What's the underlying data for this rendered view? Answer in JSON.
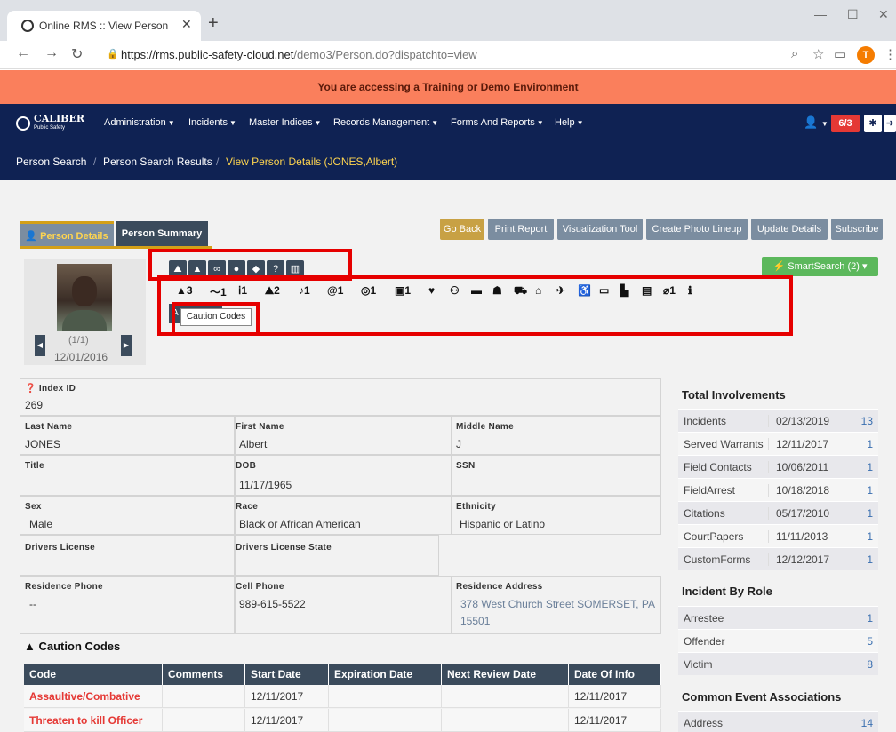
{
  "browser": {
    "tab_title": "Online RMS :: View Person Details",
    "url_host": "https://rms.public-safety-cloud.net",
    "url_path": "/demo3/Person.do?dispatchto=view",
    "profile_initial": "T"
  },
  "banner": "You are accessing a Training or Demo Environment",
  "nav": {
    "logo": "CALIBER",
    "logo_sub": "Public Safety",
    "menus": [
      "Administration",
      "Incidents",
      "Master Indices",
      "Records Management",
      "Forms And Reports",
      "Help"
    ],
    "badge": "6/3"
  },
  "breadcrumb": [
    "Person Search",
    "Person Search Results",
    "View Person Details (JONES,Albert)"
  ],
  "actions": [
    "Go Back",
    "Print Report",
    "Visualization Tool",
    "Create Photo Lineup",
    "Update Details",
    "Subscribe"
  ],
  "tabs": [
    "Person Details",
    "Person Summary"
  ],
  "photo": {
    "count": "(1/1)",
    "date": "12/01/2016"
  },
  "smartsearch": "SmartSearch (2)",
  "indicators": [
    {
      "icon": "warning-icon",
      "glyph": "▲",
      "count": "3"
    },
    {
      "icon": "alias-icon",
      "glyph": "～",
      "count": "1"
    },
    {
      "icon": "person-icon",
      "glyph": "👤",
      "count": "1"
    },
    {
      "icon": "group-icon",
      "glyph": "👥",
      "count": "2"
    },
    {
      "icon": "phone-icon",
      "glyph": "☎",
      "count": "1"
    },
    {
      "icon": "email-icon",
      "glyph": "@",
      "count": "1"
    },
    {
      "icon": "identifier-icon",
      "glyph": "◎",
      "count": "1"
    },
    {
      "icon": "id-card-icon",
      "glyph": "▣",
      "count": "1"
    }
  ],
  "tooltip": "Caution Codes",
  "small_button_label": "A",
  "fields": {
    "index_id_label": "Index ID",
    "index_id": "269",
    "last_name_label": "Last Name",
    "last_name": "JONES",
    "first_name_label": "First Name",
    "first_name": "Albert",
    "middle_name_label": "Middle Name",
    "middle_name": "J",
    "title_label": "Title",
    "title": "",
    "dob_label": "DOB",
    "dob": "11/17/1965",
    "ssn_label": "SSN",
    "ssn": "",
    "sex_label": "Sex",
    "sex": "Male",
    "race_label": "Race",
    "race": "Black or African American",
    "ethnicity_label": "Ethnicity",
    "ethnicity": "Hispanic or Latino",
    "dl_label": "Drivers License",
    "dl": "",
    "dl_state_label": "Drivers License State",
    "dl_state": "",
    "res_phone_label": "Residence Phone",
    "res_phone": "--",
    "cell_label": "Cell Phone",
    "cell": "989-615-5522",
    "address_label": "Residence Address",
    "address_1": "378 West Church Street SOMERSET, PA",
    "address_2": "15501"
  },
  "total_involvements": {
    "title": "Total Involvements",
    "rows": [
      {
        "label": "Incidents",
        "date": "02/13/2019",
        "count": "13"
      },
      {
        "label": "Served Warrants",
        "date": "12/11/2017",
        "count": "1"
      },
      {
        "label": "Field Contacts",
        "date": "10/06/2011",
        "count": "1"
      },
      {
        "label": "FieldArrest",
        "date": "10/18/2018",
        "count": "1"
      },
      {
        "label": "Citations",
        "date": "05/17/2010",
        "count": "1"
      },
      {
        "label": "CourtPapers",
        "date": "11/11/2013",
        "count": "1"
      },
      {
        "label": "CustomForms",
        "date": "12/12/2017",
        "count": "1"
      }
    ]
  },
  "incident_by_role": {
    "title": "Incident By Role",
    "rows": [
      {
        "label": "Arrestee",
        "count": "1"
      },
      {
        "label": "Offender",
        "count": "5"
      },
      {
        "label": "Victim",
        "count": "8"
      }
    ]
  },
  "common_event": {
    "title": "Common Event Associations",
    "rows": [
      {
        "label": "Address",
        "count": "14"
      }
    ]
  },
  "caution_codes": {
    "title": "Caution Codes",
    "headers": [
      "Code",
      "Comments",
      "Start Date",
      "Expiration Date",
      "Next Review Date",
      "Date Of Info"
    ],
    "rows": [
      {
        "code": "Assaultive/Combative",
        "comments": "",
        "start": "12/11/2017",
        "exp": "",
        "review": "",
        "info": "12/11/2017"
      },
      {
        "code": "Threaten to kill Officer",
        "comments": "",
        "start": "12/11/2017",
        "exp": "",
        "review": "",
        "info": "12/11/2017"
      }
    ]
  }
}
